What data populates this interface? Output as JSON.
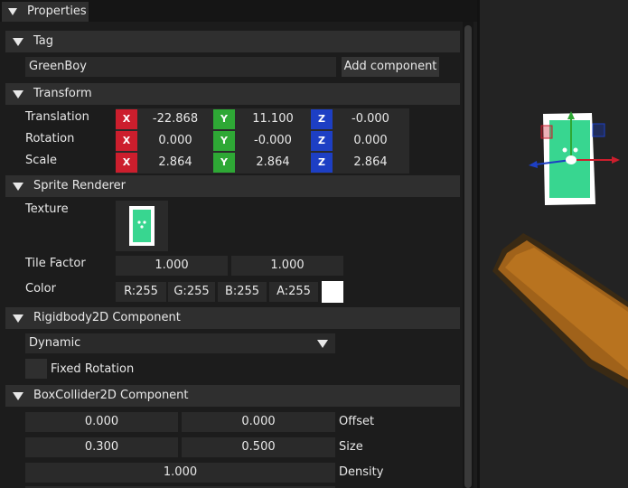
{
  "panel_title": "Properties",
  "tag": {
    "header": "Tag",
    "value": "GreenBoy",
    "add_component": "Add component"
  },
  "transform": {
    "header": "Transform",
    "axis_labels": [
      "X",
      "Y",
      "Z"
    ],
    "rows": [
      {
        "label": "Translation",
        "x": "-22.868",
        "y": "11.100",
        "z": "-0.000"
      },
      {
        "label": "Rotation",
        "x": "0.000",
        "y": "-0.000",
        "z": "0.000"
      },
      {
        "label": "Scale",
        "x": "2.864",
        "y": "2.864",
        "z": "2.864"
      }
    ],
    "colors": {
      "x": "#cc1e2d",
      "y": "#2ea835",
      "z": "#1d3fc4"
    }
  },
  "sprite": {
    "header": "Sprite Renderer",
    "texture_label": "Texture",
    "texture_icon": "green-character-sprite",
    "tile_factor_label": "Tile Factor",
    "tile_factor": [
      "1.000",
      "1.000"
    ],
    "color_label": "Color",
    "color": {
      "r": "R:255",
      "g": "G:255",
      "b": "B:255",
      "a": "A:255"
    },
    "swatch": "#ffffff"
  },
  "rigidbody": {
    "header": "Rigidbody2D Component",
    "body_type": "Dynamic",
    "fixed_rotation_label": "Fixed Rotation",
    "fixed_rotation": false
  },
  "boxcollider": {
    "header": "BoxCollider2D Component",
    "offset": [
      "0.000",
      "0.000"
    ],
    "offset_label": "Offset",
    "size": [
      "0.300",
      "0.500"
    ],
    "size_label": "Size",
    "density": "1.000",
    "density_label": "Density"
  }
}
